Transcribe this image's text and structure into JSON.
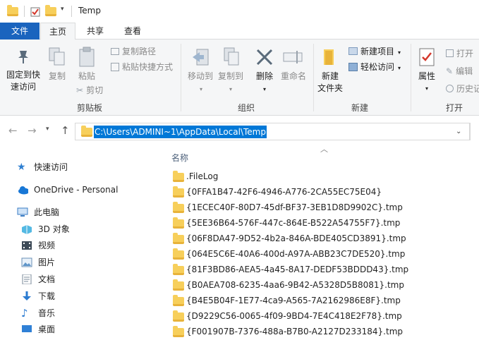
{
  "window": {
    "title": "Temp"
  },
  "tabs": [
    {
      "label": "文件"
    },
    {
      "label": "主页"
    },
    {
      "label": "共享"
    },
    {
      "label": "查看"
    }
  ],
  "ribbon": {
    "clipboard": {
      "pin_label_1": "固定到快",
      "pin_label_2": "速访问",
      "copy_label": "复制",
      "paste_label": "粘贴",
      "copy_path": "复制路径",
      "paste_shortcut": "粘贴快捷方式",
      "cut": "剪切",
      "group_label": "剪贴板"
    },
    "organize": {
      "move_to": "移动到",
      "copy_to": "复制到",
      "delete": "删除",
      "rename": "重命名",
      "group_label": "组织"
    },
    "new": {
      "new_folder_1": "新建",
      "new_folder_2": "文件夹",
      "new_item": "新建项目",
      "easy_access": "轻松访问",
      "group_label": "新建"
    },
    "open": {
      "properties": "属性",
      "open": "打开",
      "edit": "编辑",
      "history": "历史记",
      "group_label": "打开"
    }
  },
  "address": {
    "path": "C:\\Users\\ADMINI~1\\AppData\\Local\\Temp"
  },
  "sidebar": {
    "quick_access": "快速访问",
    "onedrive": "OneDrive - Personal",
    "this_pc": "此电脑",
    "items": [
      {
        "label": "3D 对象",
        "icon": "3d-objects-icon"
      },
      {
        "label": "视频",
        "icon": "video-icon"
      },
      {
        "label": "图片",
        "icon": "pictures-icon"
      },
      {
        "label": "文档",
        "icon": "documents-icon"
      },
      {
        "label": "下载",
        "icon": "downloads-icon"
      },
      {
        "label": "音乐",
        "icon": "music-icon"
      },
      {
        "label": "桌面",
        "icon": "desktop-icon"
      }
    ]
  },
  "list": {
    "column_name": "名称",
    "files": [
      ".FileLog",
      "{0FFA1B47-42F6-4946-A776-2CA55EC75E04}",
      "{1ECEC40F-80D7-45df-BF37-3EB1D8D9902C}.tmp",
      "{5EE36B64-576F-447c-864E-B522A54755F7}.tmp",
      "{06F8DA47-9D52-4b2a-846A-BDE405CD3891}.tmp",
      "{064E5C6E-40A6-400d-A97A-ABB23C7DE520}.tmp",
      "{81F3BD86-AEA5-4a45-8A17-DEDF53BDDD43}.tmp",
      "{B0AEA708-6235-4aa6-9B42-A5328D5B8081}.tmp",
      "{B4E5B04F-1E77-4ca9-A565-7A2162986E8F}.tmp",
      "{D9229C56-0065-4f09-9BD4-7E4C418E2F78}.tmp",
      "{F001907B-7376-488a-B7B0-A2127D233184}.tmp"
    ]
  },
  "colors": {
    "accent": "#1a64be",
    "selection": "#0078d7",
    "folder": "#f7cf5b"
  }
}
